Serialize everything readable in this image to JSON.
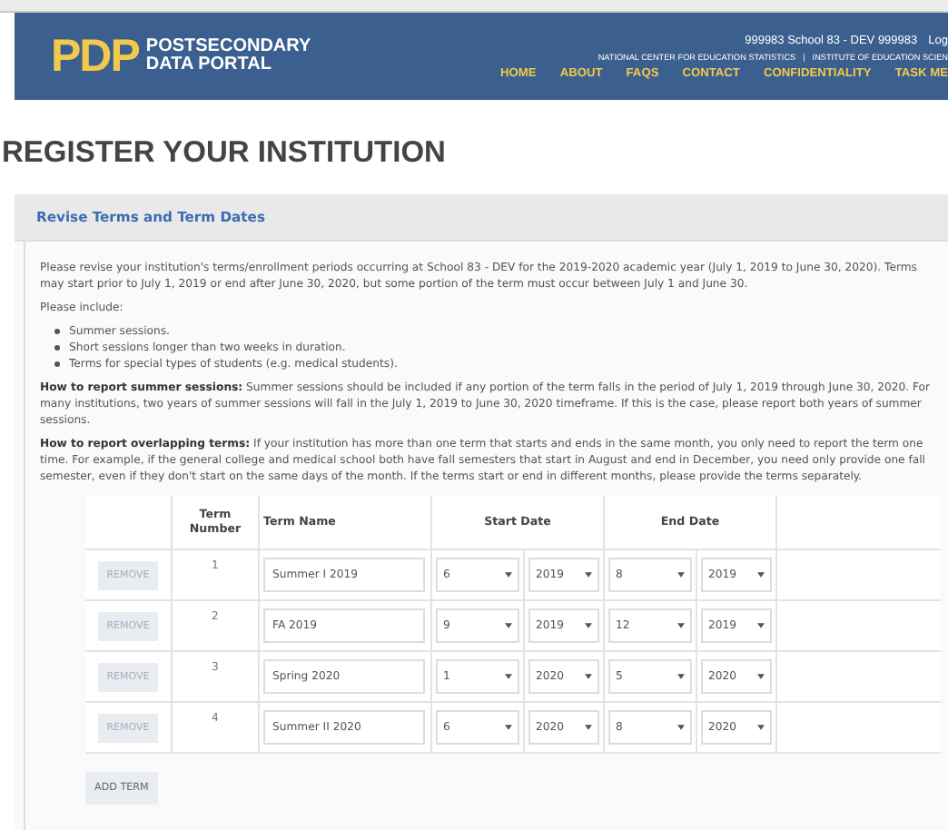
{
  "header": {
    "logo_mark": "PDP",
    "logo_text": [
      "POSTSECONDARY",
      "DATA PORTAL"
    ],
    "user_info": "999983 School 83 - DEV  999983",
    "user_link": "Log",
    "agency_links": [
      "NATIONAL CENTER FOR EDUCATION STATISTICS",
      "INSTITUTE OF EDUCATION SCIEN"
    ],
    "agency_separator": "|",
    "nav": [
      "HOME",
      "ABOUT",
      "FAQS",
      "CONTACT",
      "CONFIDENTIALITY",
      "TASK ME"
    ]
  },
  "page_title": "REGISTER YOUR INSTITUTION",
  "panel": {
    "title": "Revise Terms and Term Dates",
    "intro": "Please revise your institution's terms/enrollment periods occurring at School 83 - DEV for the 2019-2020 academic year (July 1, 2019 to June 30, 2020). Terms may start prior to July 1, 2019 or end after June 30, 2020, but some portion of the term must occur between July 1 and June 30.",
    "include_label": "Please include:",
    "include_items": [
      "Summer sessions.",
      "Short sessions longer than two weeks in duration.",
      "Terms for special types of students (e.g. medical students)."
    ],
    "notes": [
      "**How to report summer sessions:** Summer sessions should be included if any portion of the term falls in the period of July 1, 2019 through June 30, 2020. For many institutions, two years of summer sessions will fall in the July 1, 2019 to June 30, 2020 timeframe. If this is the case, please report both years of summer sessions.",
      "**How to report overlapping terms:** If your institution has more than one term that starts and ends in the same month, you only need to report the term one time. For example, if the general college and medical school both have fall semesters that start in August and end in December, you need only provide one fall semester, even if they don't start on the same days of the month. If the terms start or end in different months, please provide the terms separately."
    ],
    "table": {
      "columns": [
        "Term Number",
        "Term Name",
        "Start Date",
        "End Date"
      ],
      "rows": [
        {
          "remove": "REMOVE",
          "number": "1",
          "name": "Summer I 2019",
          "start_month": "6",
          "start_year": "2019",
          "end_month": "8",
          "end_year": "2019"
        },
        {
          "remove": "REMOVE",
          "number": "2",
          "name": "FA 2019",
          "start_month": "9",
          "start_year": "2019",
          "end_month": "12",
          "end_year": "2019"
        },
        {
          "remove": "REMOVE",
          "number": "3",
          "name": "Spring 2020",
          "start_month": "1",
          "start_year": "2020",
          "end_month": "5",
          "end_year": "2020"
        },
        {
          "remove": "REMOVE",
          "number": "4",
          "name": "Summer II 2020",
          "start_month": "6",
          "start_year": "2020",
          "end_month": "8",
          "end_year": "2020"
        }
      ]
    },
    "add_button": "ADD TERM"
  }
}
